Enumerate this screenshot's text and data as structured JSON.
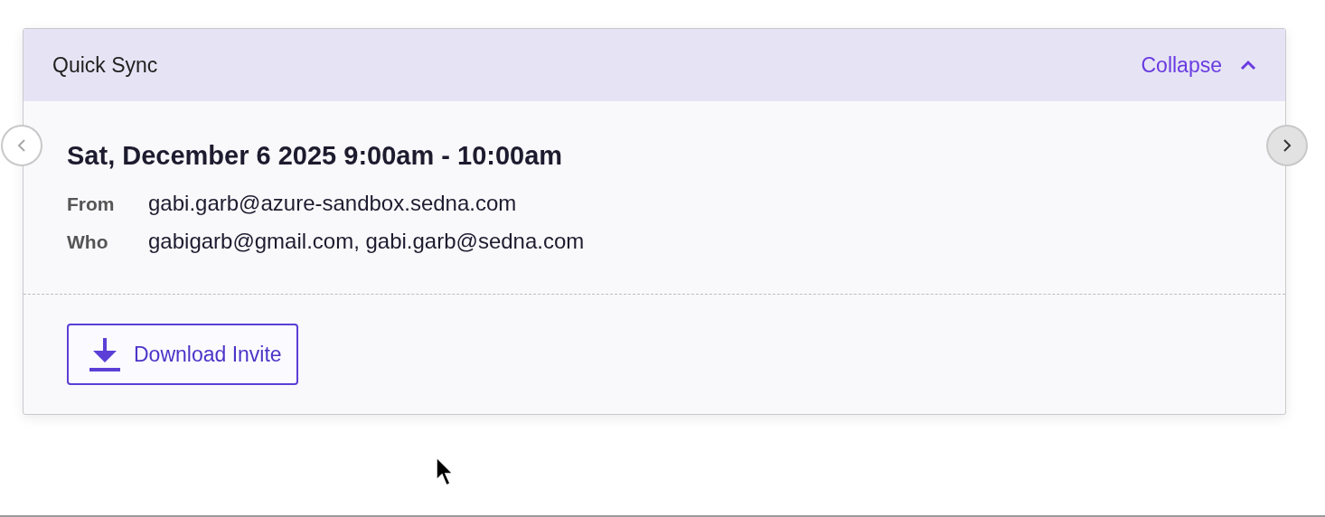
{
  "card": {
    "title": "Quick Sync",
    "toggle": {
      "label": "Collapse",
      "expanded": true
    },
    "event": {
      "when": "Sat, December 6 2025 9:00am - 10:00am",
      "details": [
        {
          "label": "From",
          "value": "gabi.garb@azure-sandbox.sedna.com"
        },
        {
          "label": "Who",
          "value": "gabigarb@gmail.com, gabi.garb@sedna.com"
        }
      ]
    },
    "action": {
      "label": "Download Invite"
    },
    "nav": [
      {
        "kind": "prev",
        "disabled": true
      },
      {
        "kind": "next",
        "disabled": false
      }
    ]
  }
}
